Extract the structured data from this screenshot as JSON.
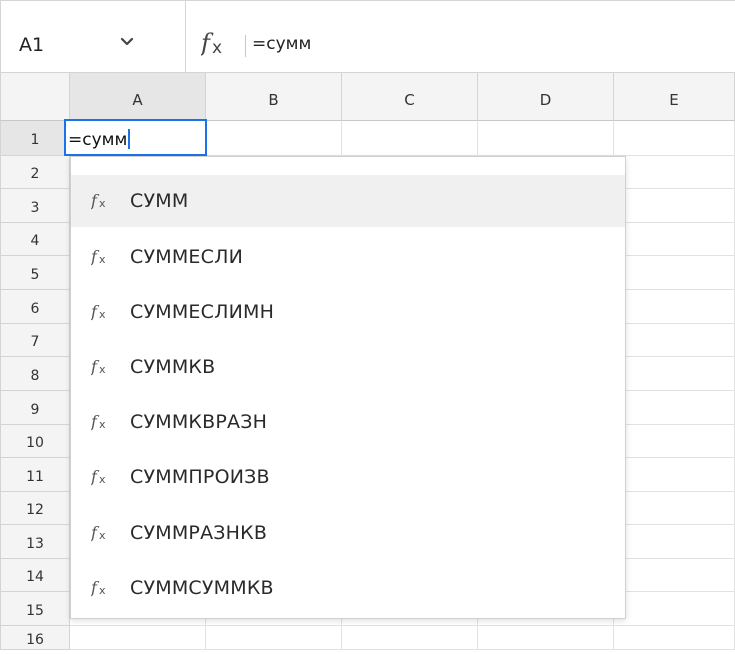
{
  "formula_bar": {
    "cell_ref": "A1",
    "formula": "=сумм",
    "icons": {
      "dropdown": "chevron-down-icon",
      "function": "fx-icon"
    }
  },
  "grid": {
    "columns": [
      "A",
      "B",
      "C",
      "D",
      "E"
    ],
    "rows": [
      "1",
      "2",
      "3",
      "4",
      "5",
      "6",
      "7",
      "8",
      "9",
      "10",
      "11",
      "12",
      "13",
      "14",
      "15",
      "16"
    ],
    "active_cell": {
      "ref": "A1",
      "value": "=сумм"
    }
  },
  "autocomplete": {
    "items": [
      {
        "label": "СУММ",
        "icon": "fx-icon",
        "selected": true
      },
      {
        "label": "СУММЕСЛИ",
        "icon": "fx-icon",
        "selected": false
      },
      {
        "label": "СУММЕСЛИМН",
        "icon": "fx-icon",
        "selected": false
      },
      {
        "label": "СУММКВ",
        "icon": "fx-icon",
        "selected": false
      },
      {
        "label": "СУММКВРАЗН",
        "icon": "fx-icon",
        "selected": false
      },
      {
        "label": "СУММПРОИЗВ",
        "icon": "fx-icon",
        "selected": false
      },
      {
        "label": "СУММРАЗНКВ",
        "icon": "fx-icon",
        "selected": false
      },
      {
        "label": "СУММСУММКВ",
        "icon": "fx-icon",
        "selected": false
      }
    ]
  },
  "colors": {
    "accent": "#1a73e8",
    "header_bg": "#f4f4f4",
    "selected_header_bg": "#e6e6e6",
    "gridline": "#e2e2e2",
    "dropdown_highlight": "#f0f0f0"
  }
}
